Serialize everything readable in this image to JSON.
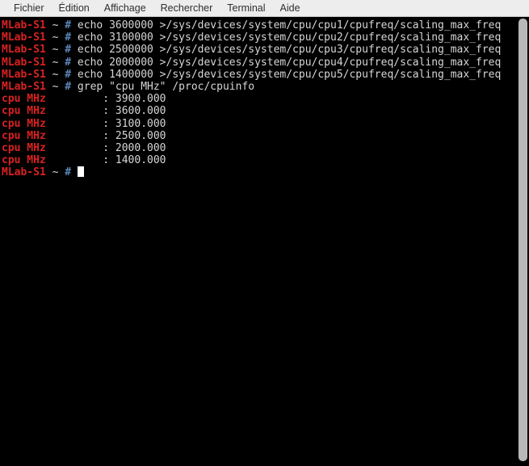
{
  "window": {
    "title": "Terminal",
    "background": "#000000",
    "foreground": "#d6d6d6",
    "prompt_host_color": "#d92121",
    "prompt_hash_color": "#5c87b8",
    "grep_match_color": "#d92121",
    "menubar_background": "#ededed"
  },
  "menubar": {
    "items": [
      {
        "label": "Fichier"
      },
      {
        "label": "Édition"
      },
      {
        "label": "Affichage"
      },
      {
        "label": "Rechercher"
      },
      {
        "label": "Terminal"
      },
      {
        "label": "Aide"
      }
    ]
  },
  "terminal": {
    "host": "MLab-S1",
    "cwd": "~",
    "prompt_symbol": "#",
    "lines": [
      {
        "type": "command",
        "host": "MLab-S1",
        "cwd": "~",
        "symbol": "#",
        "command": " echo 3600000 >/sys/devices/system/cpu/cpu1/cpufreq/scaling_max_freq"
      },
      {
        "type": "command",
        "host": "MLab-S1",
        "cwd": "~",
        "symbol": "#",
        "command": " echo 3100000 >/sys/devices/system/cpu/cpu2/cpufreq/scaling_max_freq"
      },
      {
        "type": "command",
        "host": "MLab-S1",
        "cwd": "~",
        "symbol": "#",
        "command": " echo 2500000 >/sys/devices/system/cpu/cpu3/cpufreq/scaling_max_freq"
      },
      {
        "type": "command",
        "host": "MLab-S1",
        "cwd": "~",
        "symbol": "#",
        "command": " echo 2000000 >/sys/devices/system/cpu/cpu4/cpufreq/scaling_max_freq"
      },
      {
        "type": "command",
        "host": "MLab-S1",
        "cwd": "~",
        "symbol": "#",
        "command": " echo 1400000 >/sys/devices/system/cpu/cpu5/cpufreq/scaling_max_freq"
      },
      {
        "type": "command",
        "host": "MLab-S1",
        "cwd": "~",
        "symbol": "#",
        "command": " grep \"cpu MHz\" /proc/cpuinfo"
      },
      {
        "type": "output",
        "match": "cpu MHz",
        "rest": "\t\t: 3900.000"
      },
      {
        "type": "output",
        "match": "cpu MHz",
        "rest": "\t\t: 3600.000"
      },
      {
        "type": "output",
        "match": "cpu MHz",
        "rest": "\t\t: 3100.000"
      },
      {
        "type": "output",
        "match": "cpu MHz",
        "rest": "\t\t: 2500.000"
      },
      {
        "type": "output",
        "match": "cpu MHz",
        "rest": "\t\t: 2000.000"
      },
      {
        "type": "output",
        "match": "cpu MHz",
        "rest": "\t\t: 1400.000"
      },
      {
        "type": "prompt",
        "host": "MLab-S1",
        "cwd": "~",
        "symbol": "#",
        "command": " "
      }
    ],
    "cpu_mhz_values": [
      "3900.000",
      "3600.000",
      "3100.000",
      "2500.000",
      "2000.000",
      "1400.000"
    ]
  },
  "scrollbar": {
    "orientation": "vertical",
    "thumb_position": "full"
  }
}
